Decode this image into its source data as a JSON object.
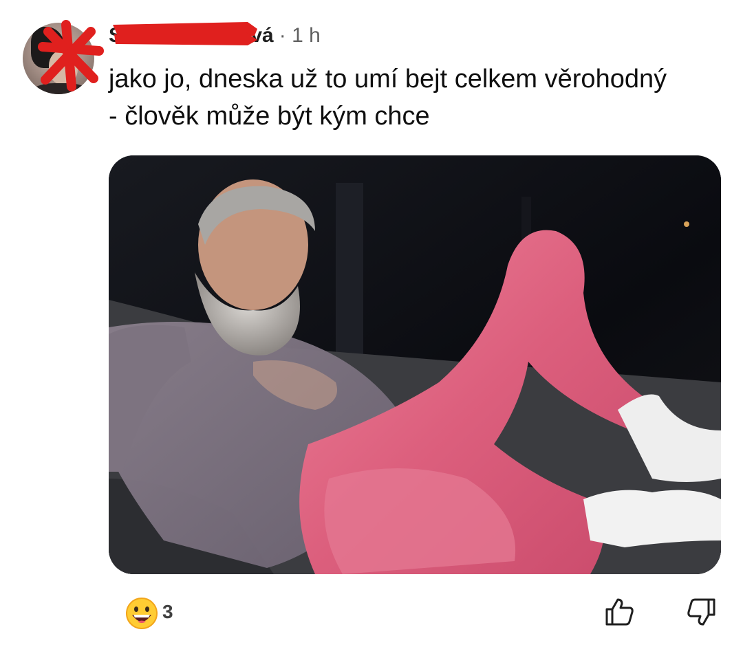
{
  "comment": {
    "author_visible": "ová",
    "author_prefix_visible": "S",
    "separator": "·",
    "time": "1 h",
    "text": "jako jo, dneska už to umí bejt celkem věrohodný - člověk může být kým chce",
    "text_line1": "jako jo, dneska už to umí bejt celkem věrohodný",
    "text_line2": "- člověk může být kým chce"
  },
  "reactions": {
    "emoji": "grinning-face-emoji",
    "count": "3"
  },
  "actions": {
    "like_icon": "thumbs-up-icon",
    "dislike_icon": "thumbs-down-icon"
  },
  "colors": {
    "redaction": "#e0201e",
    "leggings": "#e06a86",
    "background_dark": "#0c0d12"
  }
}
